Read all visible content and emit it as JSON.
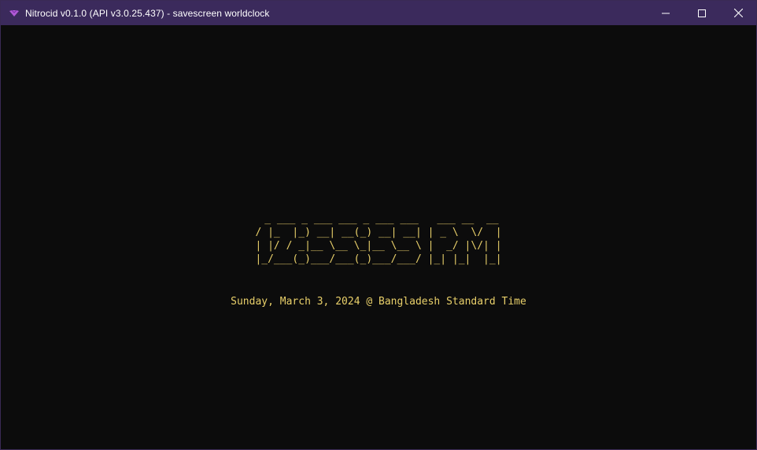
{
  "window": {
    "title": "Nitrocid v0.1.0 (API v3.0.25.437) - savescreen worldclock",
    "icon": "nitrocid-app-icon",
    "controls": {
      "minimize_icon": "minimize-icon",
      "maximize_icon": "maximize-icon",
      "close_icon": "close-icon"
    }
  },
  "colors": {
    "titlebar": "#3b2a5c",
    "terminal_bg": "#0c0c0c",
    "text_yellow": "#e9d06a"
  },
  "screensaver": {
    "name": "worldclock",
    "ascii_time": "  _ ___ _ ___ ___ _ ___ ___   ___ __  __ \n/ |_  |_) __| __(_) __| __| | _ \\  \\/  |\n| |/ / _|__ \\__ \\_|__ \\__ \\ |  _/ |\\/| |\n|_/___(_)___/___(_)___/___/ |_| |_|  |_|",
    "date_line": "Sunday, March 3, 2024 @ Bangladesh Standard Time"
  }
}
